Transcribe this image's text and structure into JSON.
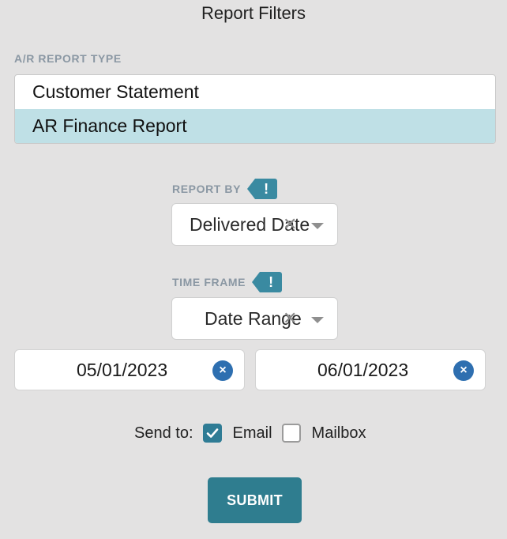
{
  "title": "Report Filters",
  "report_type": {
    "label": "A/R REPORT TYPE",
    "items": [
      {
        "label": "Customer Statement",
        "selected": false
      },
      {
        "label": "AR Finance Report",
        "selected": true
      }
    ]
  },
  "report_by": {
    "label": "REPORT BY",
    "tag": "!",
    "value": "Delivered Date",
    "clear": "✕"
  },
  "time_frame": {
    "label": "TIME FRAME",
    "tag": "!",
    "value": "Date Range",
    "clear": "✕"
  },
  "date_range": {
    "start": "05/01/2023",
    "end": "06/01/2023",
    "clear": "×"
  },
  "send_to": {
    "label": "Send to:",
    "email": {
      "label": "Email",
      "checked": true
    },
    "mailbox": {
      "label": "Mailbox",
      "checked": false
    }
  },
  "submit_label": "SUBMIT",
  "colors": {
    "accent": "#2f7d8f",
    "selection": "#bfe0e6",
    "tag": "#3a8aa1",
    "clear_button": "#2e6fb0",
    "background": "#e3e2e2"
  },
  "icons": {
    "tag": "exclamation-icon",
    "clear": "close-icon",
    "caret": "chevron-down-icon",
    "check": "check-icon"
  }
}
